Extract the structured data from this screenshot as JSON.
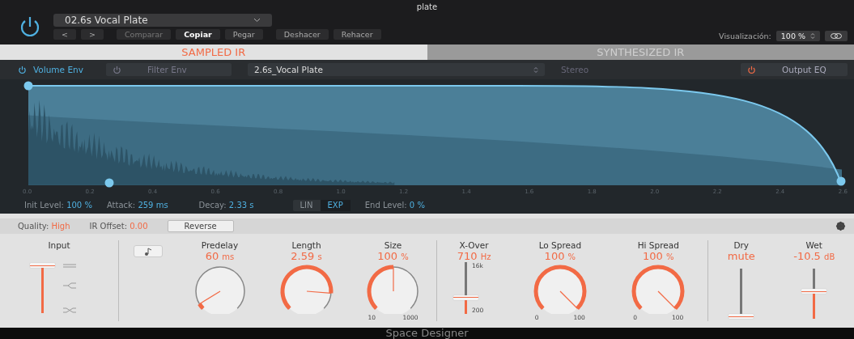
{
  "window": {
    "title": "plate"
  },
  "header": {
    "power_on": true,
    "preset": "02.6s Vocal Plate",
    "buttons": [
      {
        "label": "<",
        "disabled": false,
        "active": false
      },
      {
        "label": ">",
        "disabled": false,
        "active": false
      },
      {
        "label": "Comparar",
        "disabled": true,
        "active": false
      },
      {
        "label": "Copiar",
        "disabled": false,
        "active": true
      },
      {
        "label": "Pegar",
        "disabled": false,
        "active": false
      },
      {
        "label": "Deshacer",
        "disabled": false,
        "active": false
      },
      {
        "label": "Rehacer",
        "disabled": false,
        "active": false
      }
    ],
    "view_label": "Visualización:",
    "view_value": "100 %"
  },
  "tabs": [
    {
      "label": "SAMPLED IR",
      "selected": true
    },
    {
      "label": "SYNTHESIZED IR",
      "selected": false
    }
  ],
  "toolbar": {
    "volume_env": {
      "label": "Volume Env",
      "on": true
    },
    "filter_env": {
      "label": "Filter Env",
      "on": false
    },
    "ir_file": "2.6s_Vocal Plate",
    "stereo": "Stereo",
    "output_eq": {
      "label": "Output EQ",
      "on": true
    }
  },
  "envelope": {
    "axis_ticks": [
      "0.0",
      "0.2",
      "0.4",
      "0.6",
      "0.8",
      "1.0",
      "1.2",
      "1.4",
      "1.6",
      "1.8",
      "2.0",
      "2.2",
      "2.4",
      "2.6"
    ],
    "params": [
      {
        "label": "Init Level:",
        "value": "100 %"
      },
      {
        "label": "Attack:",
        "value": "259 ms"
      },
      {
        "label": "Decay:",
        "value": "2.33 s"
      }
    ],
    "curve": [
      {
        "label": "LIN",
        "selected": false
      },
      {
        "label": "EXP",
        "selected": true
      }
    ],
    "end_level": {
      "label": "End Level:",
      "value": "0 %"
    }
  },
  "settings": {
    "quality_label": "Quality:",
    "quality_value": "High",
    "offset_label": "IR Offset:",
    "offset_value": "0.00",
    "reverse": "Reverse"
  },
  "input": {
    "label": "Input",
    "level": 1.0
  },
  "knobs": [
    {
      "label": "Predelay",
      "value": "60",
      "unit": "ms"
    },
    {
      "label": "Length",
      "value": "2.59",
      "unit": "s"
    },
    {
      "label": "Size",
      "value": "100",
      "unit": "%",
      "min": "10",
      "max": "1000"
    }
  ],
  "xover": {
    "label": "X-Over",
    "value": "710",
    "unit": "Hz",
    "max": "16k",
    "min": "200"
  },
  "spread_knobs": [
    {
      "label": "Lo Spread",
      "value": "100",
      "unit": "%",
      "min": "0",
      "max": "100"
    },
    {
      "label": "Hi Spread",
      "value": "100",
      "unit": "%",
      "min": "0",
      "max": "100"
    }
  ],
  "mix": [
    {
      "label": "Dry",
      "value": "mute",
      "level": 0.0
    },
    {
      "label": "Wet",
      "value": "-10.5",
      "unit": "dB",
      "level": 0.55
    }
  ],
  "footer": "Space Designer"
}
